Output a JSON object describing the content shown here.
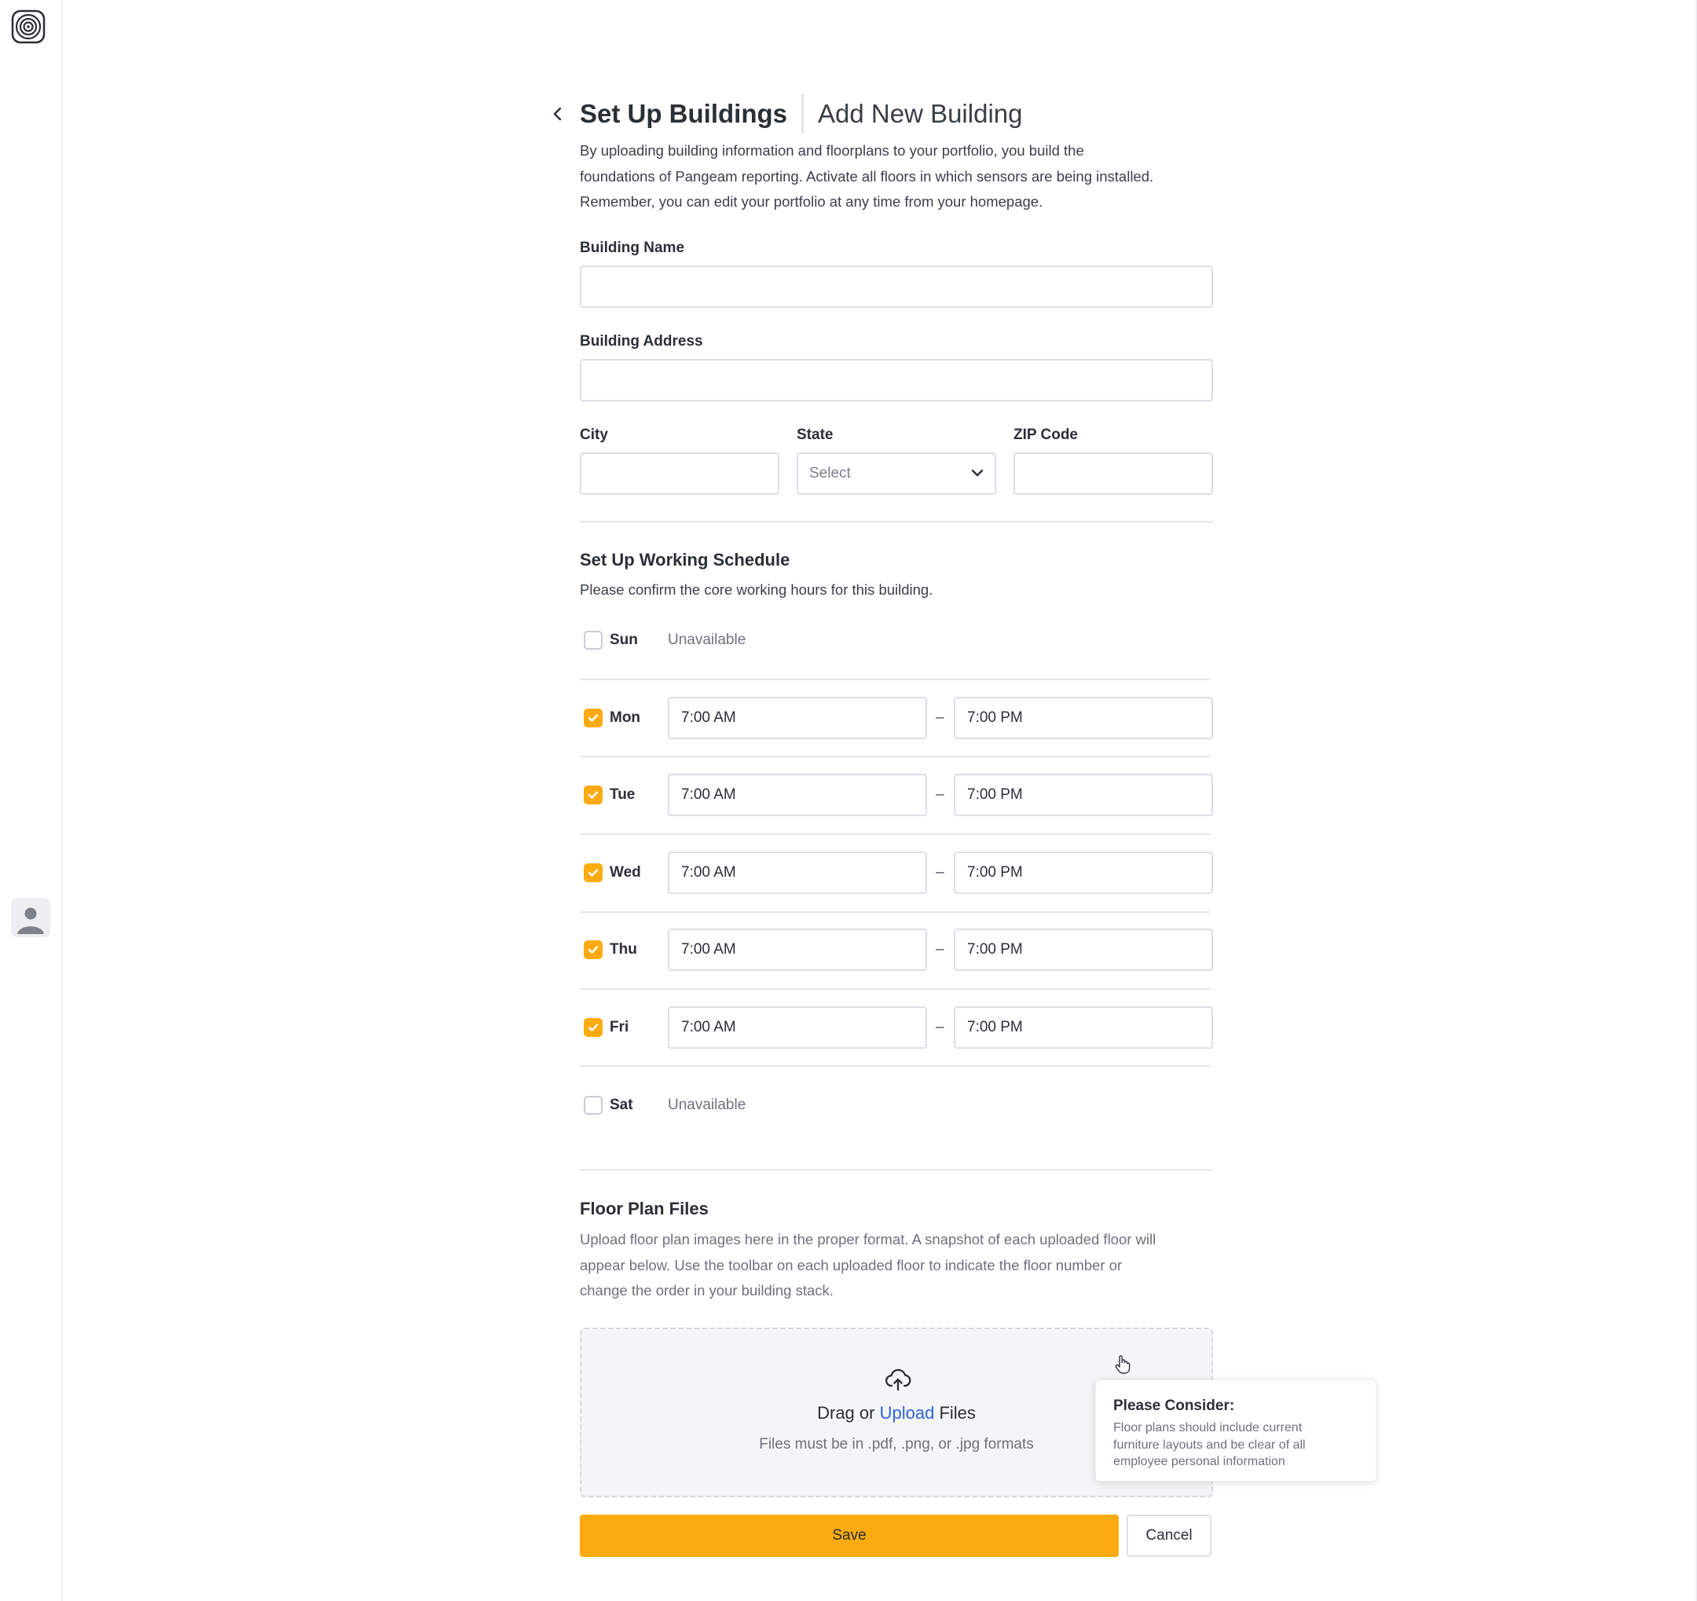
{
  "header": {
    "title": "Set Up Buildings",
    "subtitle": "Add New Building",
    "intro_lines": [
      "By uploading building information and floorplans to your portfolio, you build the",
      "foundations of Pangeam reporting. Activate all floors in which sensors are being installed.",
      "Remember, you can edit your portfolio at any time from your homepage."
    ]
  },
  "form": {
    "building_name_label": "Building Name",
    "building_name_value": "",
    "building_address_label": "Building Address",
    "building_address_value": "",
    "city_label": "City",
    "city_value": "",
    "state_label": "State",
    "state_selected": "Select",
    "zip_label": "ZIP Code",
    "zip_value": ""
  },
  "schedule": {
    "title": "Set Up Working Schedule",
    "description": "Please confirm the core working hours for this building.",
    "unavailable_label": "Unavailable",
    "separator": "–",
    "days": [
      {
        "day": "Sun",
        "checked": false,
        "start": "",
        "end": ""
      },
      {
        "day": "Mon",
        "checked": true,
        "start": "7:00 AM",
        "end": "7:00 PM"
      },
      {
        "day": "Tue",
        "checked": true,
        "start": "7:00 AM",
        "end": "7:00 PM"
      },
      {
        "day": "Wed",
        "checked": true,
        "start": "7:00 AM",
        "end": "7:00 PM"
      },
      {
        "day": "Thu",
        "checked": true,
        "start": "7:00 AM",
        "end": "7:00 PM"
      },
      {
        "day": "Fri",
        "checked": true,
        "start": "7:00 AM",
        "end": "7:00 PM"
      },
      {
        "day": "Sat",
        "checked": false,
        "start": "",
        "end": ""
      }
    ]
  },
  "floorplans": {
    "title": "Floor Plan Files",
    "description_lines": [
      "Upload floor plan images here in the proper format. A snapshot of each uploaded floor will",
      "appear below.  Use the toolbar on each uploaded floor to indicate the floor number or",
      "change the order in your building stack."
    ],
    "drop_prefix": "Drag or",
    "drop_link": "Upload",
    "drop_suffix": "Files",
    "formats_hint": "Files must be in .pdf, .png, or .jpg formats"
  },
  "tooltip": {
    "title": "Please Consider:",
    "body_lines": [
      "Floor plans should include current",
      "furniture layouts and be clear of all",
      "employee personal information"
    ]
  },
  "actions": {
    "save_label": "Save",
    "cancel_label": "Cancel"
  },
  "colors": {
    "accent": "#fbab10",
    "link": "#2e63d4"
  },
  "icons": {
    "logo": "concentric-circles-logo-icon",
    "back": "chevron-left-icon",
    "select": "chevron-down-icon",
    "upload": "cloud-upload-icon",
    "avatar": "user-icon",
    "cursor": "hand-pointer-icon"
  }
}
